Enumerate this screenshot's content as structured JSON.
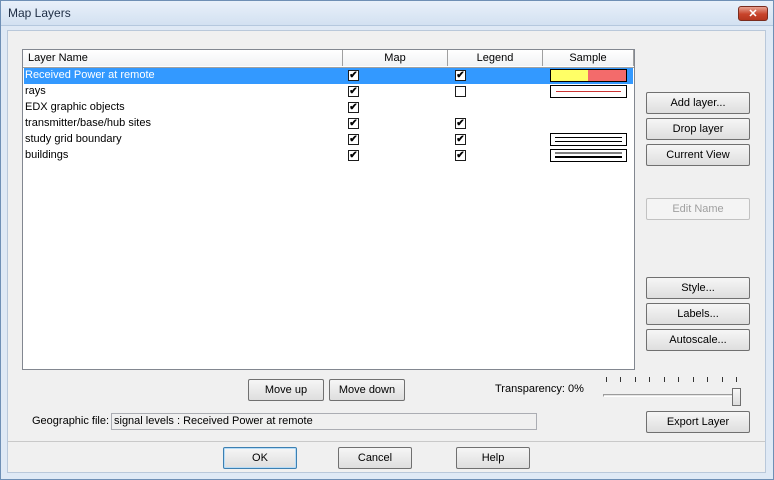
{
  "window": {
    "title": "Map Layers",
    "close_glyph": "✕"
  },
  "table": {
    "headers": {
      "name": "Layer Name",
      "map": "Map",
      "legend": "Legend",
      "sample": "Sample"
    },
    "rows": [
      {
        "name": "Received Power at remote",
        "map": true,
        "legend": true,
        "sample": "signal-levels",
        "selected": true
      },
      {
        "name": "rays",
        "map": true,
        "legend": false,
        "sample": "thin-red-line",
        "selected": false
      },
      {
        "name": "EDX graphic objects",
        "map": true,
        "legend": null,
        "sample": null,
        "selected": false
      },
      {
        "name": "transmitter/base/hub sites",
        "map": true,
        "legend": true,
        "sample": null,
        "selected": false
      },
      {
        "name": "study grid boundary",
        "map": true,
        "legend": true,
        "sample": "double-line",
        "selected": false
      },
      {
        "name": "buildings",
        "map": true,
        "legend": true,
        "sample": "thick-double-line",
        "selected": false
      }
    ]
  },
  "side_buttons": {
    "add_layer": "Add layer...",
    "drop_layer": "Drop layer",
    "current_view": "Current View",
    "edit_name": "Edit Name",
    "style": "Style...",
    "labels": "Labels...",
    "autoscale": "Autoscale...",
    "export_layer": "Export Layer"
  },
  "move": {
    "up": "Move up",
    "down": "Move down"
  },
  "transparency": {
    "label": "Transparency: 0%",
    "value_percent": 0
  },
  "geographic": {
    "label": "Geographic file:",
    "value": "signal levels : Received Power at remote"
  },
  "footer": {
    "ok": "OK",
    "cancel": "Cancel",
    "help": "Help"
  },
  "colors": {
    "selection": "#3399ff",
    "sample_yellow": "#ffff66",
    "sample_red": "#f36b6b",
    "rays_line": "#cc3333"
  },
  "check_glyph": "✔"
}
